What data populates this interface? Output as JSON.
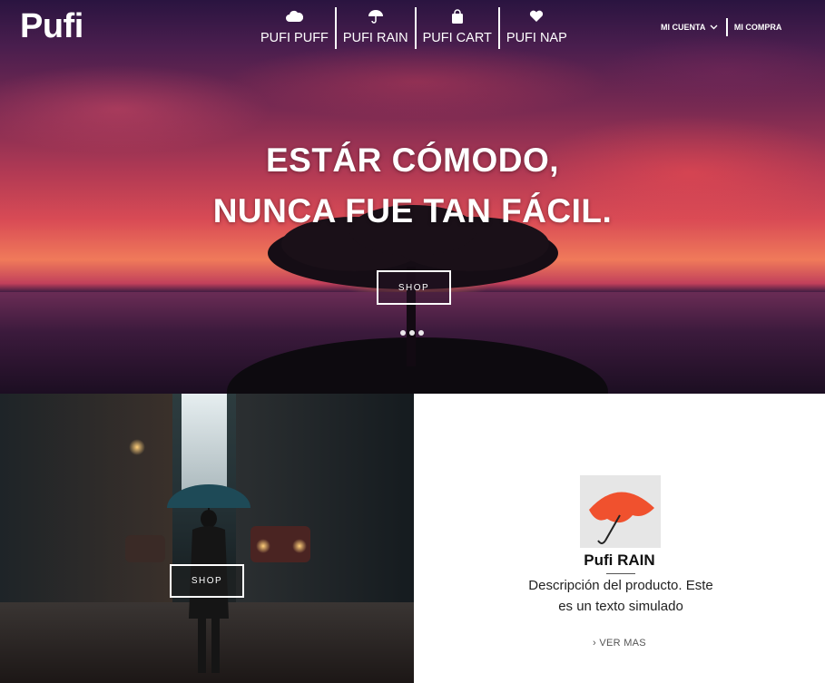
{
  "brand": {
    "logo": "Pufi"
  },
  "nav": {
    "items": [
      {
        "label": "PUFI PUFF",
        "icon": "cloud-icon"
      },
      {
        "label": "PUFI RAIN",
        "icon": "umbrella-icon"
      },
      {
        "label": "PUFI CART",
        "icon": "shopping-bag-icon"
      },
      {
        "label": "PUFI NAP",
        "icon": "heart-icon"
      }
    ],
    "account": {
      "label": "MI CUENTA",
      "icon": "chevron-down-icon"
    },
    "purchase": {
      "label": "MI COMPRA"
    }
  },
  "hero": {
    "title_line1": "ESTÁR CÓMODO,",
    "title_line2": "NUNCA FUE TAN FÁCIL.",
    "button": "SHOP",
    "slides": 3
  },
  "promo": {
    "button": "SHOP"
  },
  "product": {
    "name": "Pufi RAIN",
    "description_line1": "Descripción del producto. Este",
    "description_line2": "es un texto simulado",
    "link": "VER MAS",
    "link_icon": "chevron-right-icon"
  },
  "colors": {
    "white": "#ffffff",
    "text": "#222222",
    "muted": "#555555"
  }
}
